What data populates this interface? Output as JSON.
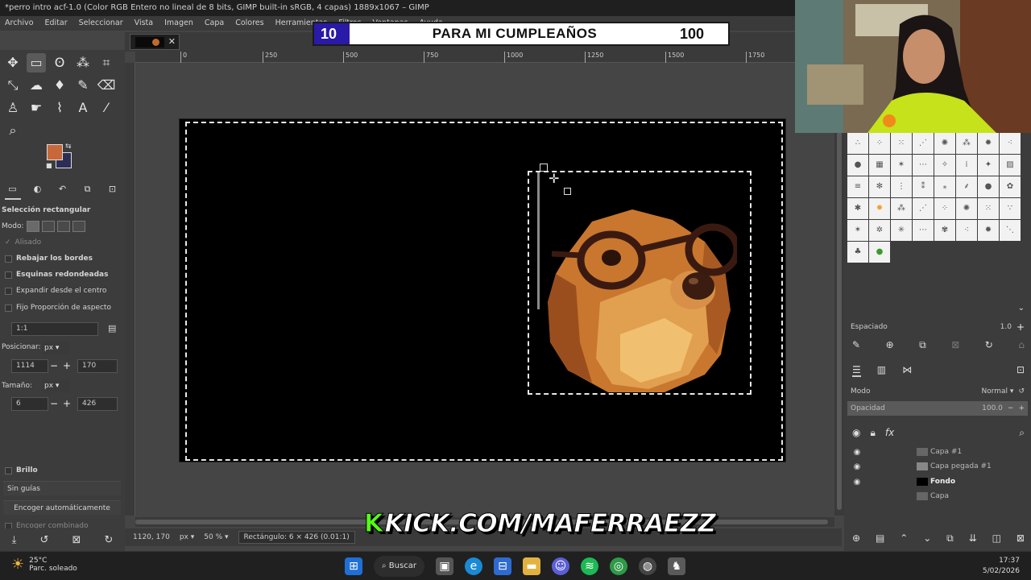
{
  "window_title": "*perro intro acf-1.0 (Color RGB Entero no lineal de 8 bits, GIMP built-in sRGB, 4 capas) 1889x1067 – GIMP",
  "menu": [
    "Archivo",
    "Editar",
    "Seleccionar",
    "Vista",
    "Imagen",
    "Capa",
    "Colores",
    "Herramientas",
    "Filtros",
    "Ventanas",
    "Ayuda"
  ],
  "banner": {
    "left_number": "10",
    "title": "PARA MI CUMPLEAÑOS",
    "right_number": "100"
  },
  "ruler_ticks": [
    "0",
    "250",
    "500",
    "750",
    "1000",
    "1250",
    "1500",
    "1750"
  ],
  "tool_options": {
    "title": "Selección rectangular",
    "mode_label": "Modo:",
    "antialias": "Alisado",
    "feather": "Rebajar los bordes",
    "rounded": "Esquinas redondeadas",
    "expand": "Expandir desde el centro",
    "fixed": "Fijo Proporción de aspecto",
    "ratio": "1:1",
    "position_label": "Posicionar:",
    "position_unit": "px",
    "position_x": "1114",
    "position_y": "170",
    "size_label": "Tamaño:",
    "size_unit": "px",
    "size_w": "6",
    "size_h": "426",
    "highlight": "Brillo",
    "guides": "Sin guías",
    "autoshrink": "Encoger automáticamente",
    "shrink_merged": "Encoger combinado"
  },
  "status": {
    "coords": "1120, 170",
    "unit": "px",
    "zoom": "50 %",
    "message": "Rectángulo: 6 × 426  (0.01:1)"
  },
  "watermark": "KICK.COM/MAFERRAEZZ",
  "brushes_panel": {
    "spacing_label": "Espaciado",
    "spacing_value": "1.0"
  },
  "layers_panel": {
    "mode_label": "Modo",
    "mode_value": "Normal",
    "opacity_label": "Opacidad",
    "opacity_value": "100.0",
    "layers": [
      {
        "name": "Capa #1",
        "visible": true,
        "bold": false
      },
      {
        "name": "Capa pegada #1",
        "visible": true,
        "bold": false
      },
      {
        "name": "Fondo",
        "visible": true,
        "bold": true
      },
      {
        "name": "Capa",
        "visible": false,
        "bold": false
      }
    ]
  },
  "taskbar": {
    "temperature": "25°C",
    "weather": "Parc. soleado",
    "search": "Buscar",
    "time": "17:37",
    "date": "5/02/2026"
  },
  "colors": {
    "foreground": "#c8673a",
    "background": "#2c2e55",
    "banner_blue": "#2a1aa8",
    "kick_green": "#53fc18"
  }
}
